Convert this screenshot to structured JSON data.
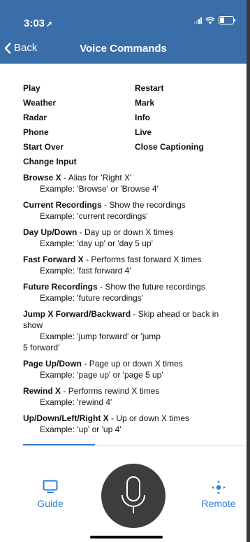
{
  "status": {
    "time": "3:03"
  },
  "nav": {
    "back_label": "Back",
    "title": "Voice Commands"
  },
  "simple_commands": [
    [
      "Play",
      "Restart"
    ],
    [
      "Weather",
      "Mark"
    ],
    [
      "Radar",
      "Info"
    ],
    [
      "Phone",
      "Live"
    ],
    [
      "Start Over",
      "Close Captioning"
    ]
  ],
  "change_input": "Change Input",
  "commands": [
    {
      "name": "Browse X",
      "desc": "Alias for 'Right X'",
      "example": "Example: 'Browse' or 'Browse 4'"
    },
    {
      "name": "Current Recordings",
      "desc": "Show the recordings",
      "example": "Example: 'current recordings'"
    },
    {
      "name": "Day Up/Down",
      "desc": "Day up or down X times",
      "example": "Example: 'day up' or 'day 5 up'"
    },
    {
      "name": "Fast Forward X",
      "desc": "Performs fast forward X times",
      "example": "Example: 'fast forward 4'"
    },
    {
      "name": "Future Recordings",
      "desc": "Show the future recordings",
      "example": "Example: 'future recordings'"
    },
    {
      "name": "Jump X Forward/Backward",
      "desc": "Skip ahead or back in show",
      "example": "Example: 'jump forward' or 'jump",
      "example_cont": "5 forward'"
    },
    {
      "name": "Page Up/Down",
      "desc": "Page up or down X times",
      "example": "Example: 'page up' or 'page 5 up'"
    },
    {
      "name": "Rewind X",
      "desc": "Performs rewind X times",
      "example": "Example: 'rewind 4'"
    },
    {
      "name": "Up/Down/Left/Right X",
      "desc": "Up or down X times",
      "example": "Example: 'up' or 'up 4'"
    }
  ],
  "bottom": {
    "guide_label": "Guide",
    "remote_label": "Remote"
  },
  "colors": {
    "header": "#3a6ea8",
    "accent": "#2f7bd8",
    "mic": "#3d3d3d"
  },
  "icons": [
    "location-arrow-icon",
    "signal-icon",
    "wifi-icon",
    "battery-icon",
    "chevron-left-icon",
    "tv-icon",
    "microphone-icon",
    "dpad-icon"
  ]
}
